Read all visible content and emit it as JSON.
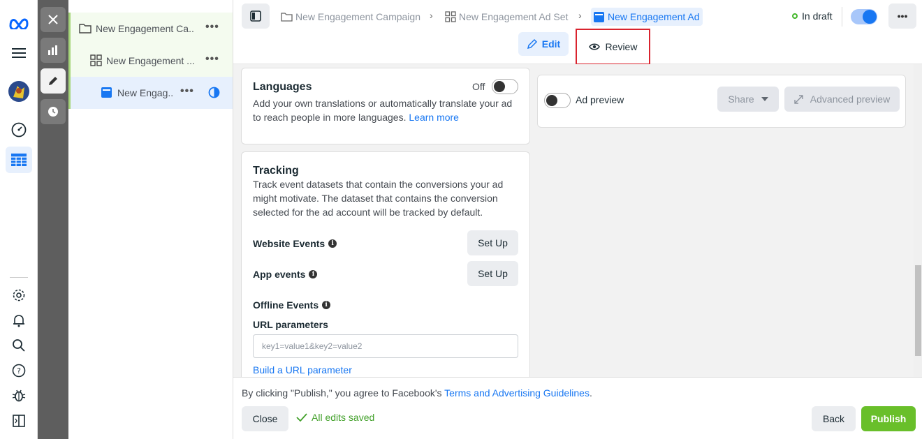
{
  "leftnav": {
    "icons": [
      "meta-logo-icon",
      "menu-icon",
      "avatar",
      "dashboard-icon",
      "table-icon",
      "settings-icon",
      "bell-icon",
      "search-icon",
      "help-icon",
      "bug-icon",
      "panel-icon"
    ]
  },
  "tree": {
    "campaign": "New Engagement Ca...",
    "adset": "New Engagement ...",
    "ad": "New Engag...",
    "more": "•••"
  },
  "header": {
    "breadcrumbs": [
      "New Engagement Campaign",
      "New Engagement Ad Set",
      "New Engagement Ad"
    ],
    "status": "In draft",
    "more": "•••",
    "tab_edit": "Edit",
    "tab_review": "Review"
  },
  "languages": {
    "title": "Languages",
    "toggle_label": "Off",
    "description": "Add your own translations or automatically translate your ad to reach people in more languages. ",
    "learn_more": "Learn more"
  },
  "tracking": {
    "title": "Tracking",
    "description": "Track event datasets that contain the conversions your ad might motivate. The dataset that contains the conversion selected for the ad account will be tracked by default.",
    "website_events": "Website Events",
    "app_events": "App events",
    "offline_events": "Offline Events",
    "setup_label": "Set Up",
    "url_parameters": "URL parameters",
    "url_placeholder": "key1=value1&key2=value2",
    "build_url": "Build a URL parameter"
  },
  "preview": {
    "label": "Ad preview",
    "share": "Share",
    "advanced": "Advanced preview"
  },
  "footer": {
    "agree_prefix": "By clicking \"Publish,\" you agree to Facebook's ",
    "agree_link": "Terms and Advertising Guidelines",
    "agree_suffix": ".",
    "close": "Close",
    "saved": "All edits saved",
    "back": "Back",
    "publish": "Publish"
  },
  "colors": {
    "accent": "#1877f2",
    "publish": "#69bf2a",
    "highlight": "#d9232e"
  }
}
